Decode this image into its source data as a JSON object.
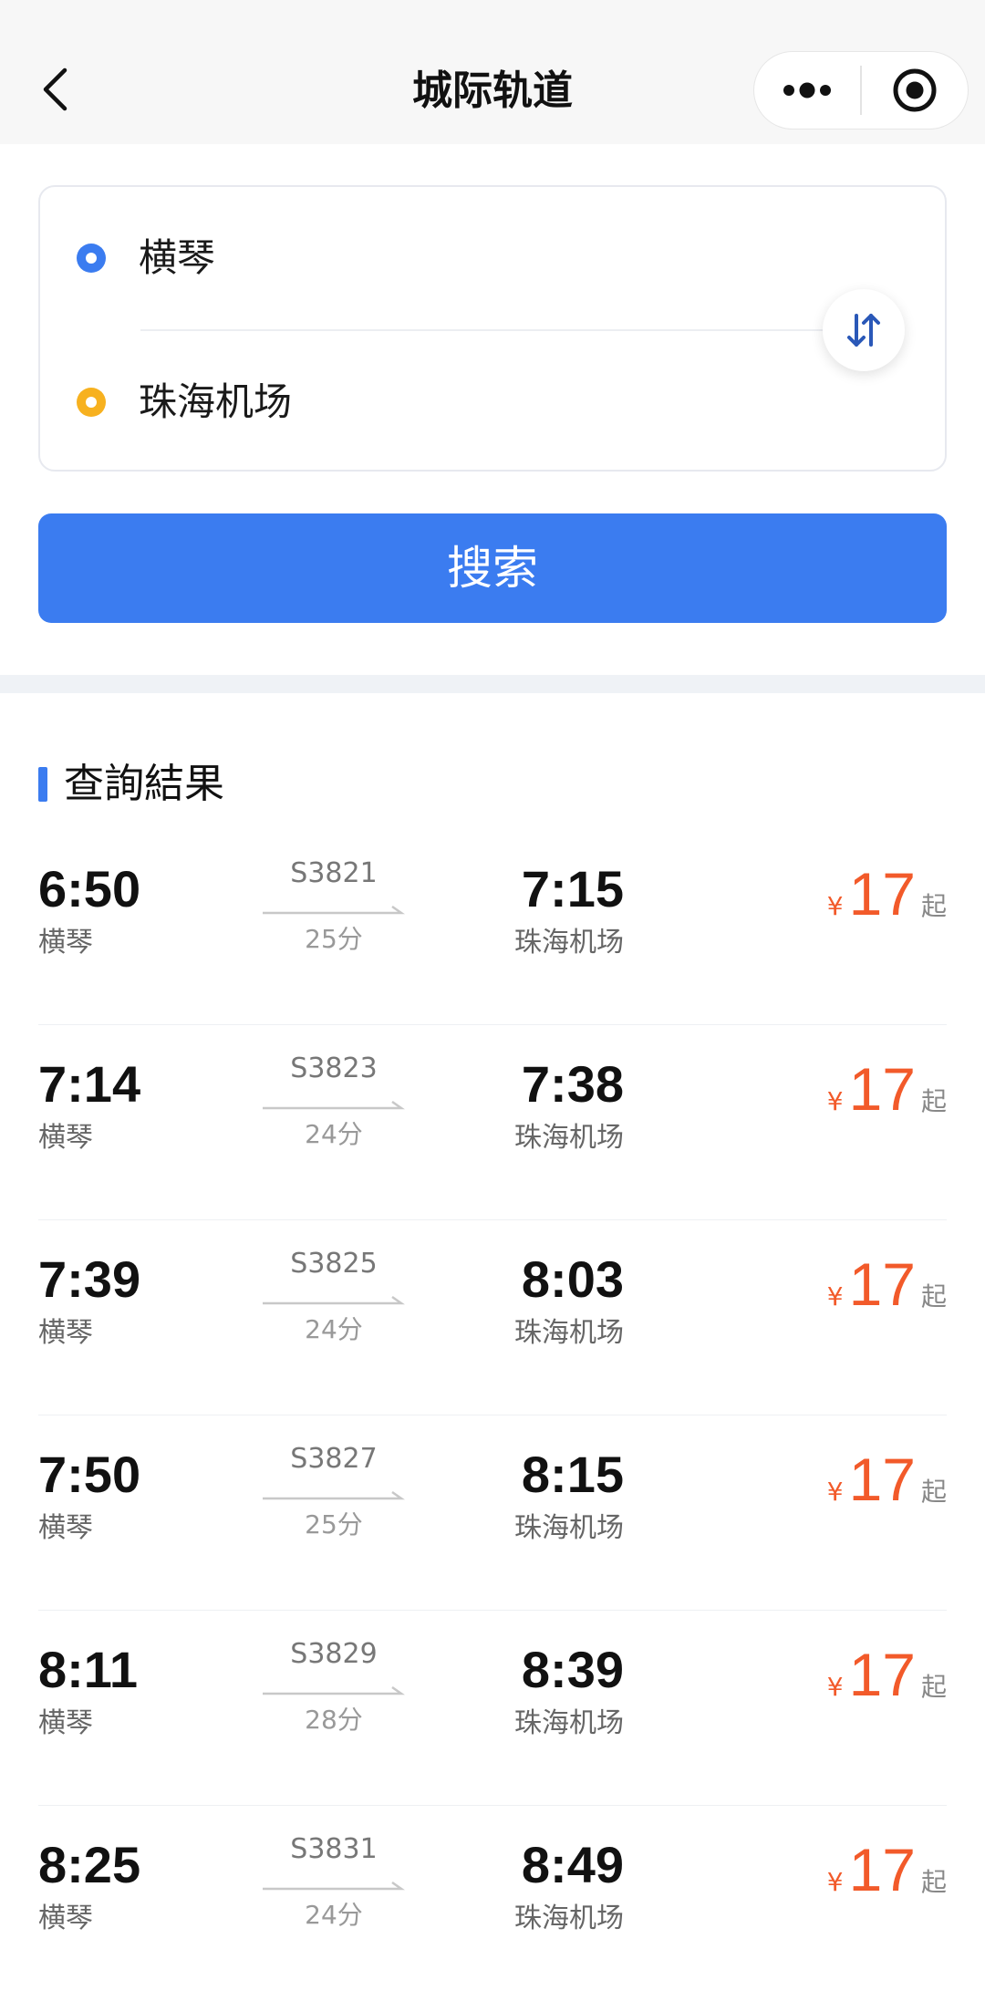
{
  "navbar": {
    "title": "城际轨道",
    "icons": {
      "back": "chevron-left-icon",
      "more": "more-dots-icon",
      "close": "target-circle-icon"
    }
  },
  "route": {
    "from_station": "横琴",
    "to_station": "珠海机场",
    "swap_icon": "swap-arrows-icon"
  },
  "search": {
    "button_label": "搜索"
  },
  "results": {
    "section_title": "查詢結果",
    "currency_symbol": "¥",
    "price_suffix": "起",
    "rows": [
      {
        "dep_time": "6:50",
        "dep_station": "横琴",
        "train_no": "S3821",
        "duration": "25分",
        "arr_time": "7:15",
        "arr_station": "珠海机场",
        "price": "17"
      },
      {
        "dep_time": "7:14",
        "dep_station": "横琴",
        "train_no": "S3823",
        "duration": "24分",
        "arr_time": "7:38",
        "arr_station": "珠海机场",
        "price": "17"
      },
      {
        "dep_time": "7:39",
        "dep_station": "横琴",
        "train_no": "S3825",
        "duration": "24分",
        "arr_time": "8:03",
        "arr_station": "珠海机场",
        "price": "17"
      },
      {
        "dep_time": "7:50",
        "dep_station": "横琴",
        "train_no": "S3827",
        "duration": "25分",
        "arr_time": "8:15",
        "arr_station": "珠海机场",
        "price": "17"
      },
      {
        "dep_time": "8:11",
        "dep_station": "横琴",
        "train_no": "S3829",
        "duration": "28分",
        "arr_time": "8:39",
        "arr_station": "珠海机场",
        "price": "17"
      },
      {
        "dep_time": "8:25",
        "dep_station": "横琴",
        "train_no": "S3831",
        "duration": "24分",
        "arr_time": "8:49",
        "arr_station": "珠海机场",
        "price": "17"
      }
    ]
  },
  "colors": {
    "primary": "#3b7cf0",
    "origin_dot": "#3b7cf0",
    "destination_dot": "#f7b11f",
    "price": "#f25a2a"
  }
}
